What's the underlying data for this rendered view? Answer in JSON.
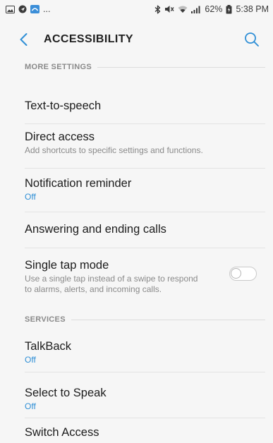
{
  "status_bar": {
    "left_overflow": "...",
    "battery": "62%",
    "time": "5:38 PM"
  },
  "header": {
    "title": "ACCESSIBILITY",
    "accent_color": "#2f8fd6"
  },
  "sections": {
    "more_settings": "MORE SETTINGS",
    "services": "SERVICES"
  },
  "items": {
    "text_to_speech": {
      "title": "Text-to-speech"
    },
    "direct_access": {
      "title": "Direct access",
      "subtitle": "Add shortcuts to specific settings and functions."
    },
    "notification_reminder": {
      "title": "Notification reminder",
      "status": "Off"
    },
    "answering_calls": {
      "title": "Answering and ending calls"
    },
    "single_tap": {
      "title": "Single tap mode",
      "subtitle": "Use a single tap instead of a swipe to respond to alarms, alerts, and incoming calls.",
      "toggle_on": false
    },
    "talkback": {
      "title": "TalkBack",
      "status": "Off"
    },
    "select_to_speak": {
      "title": "Select to Speak",
      "status": "Off"
    },
    "switch_access": {
      "title": "Switch Access"
    }
  }
}
